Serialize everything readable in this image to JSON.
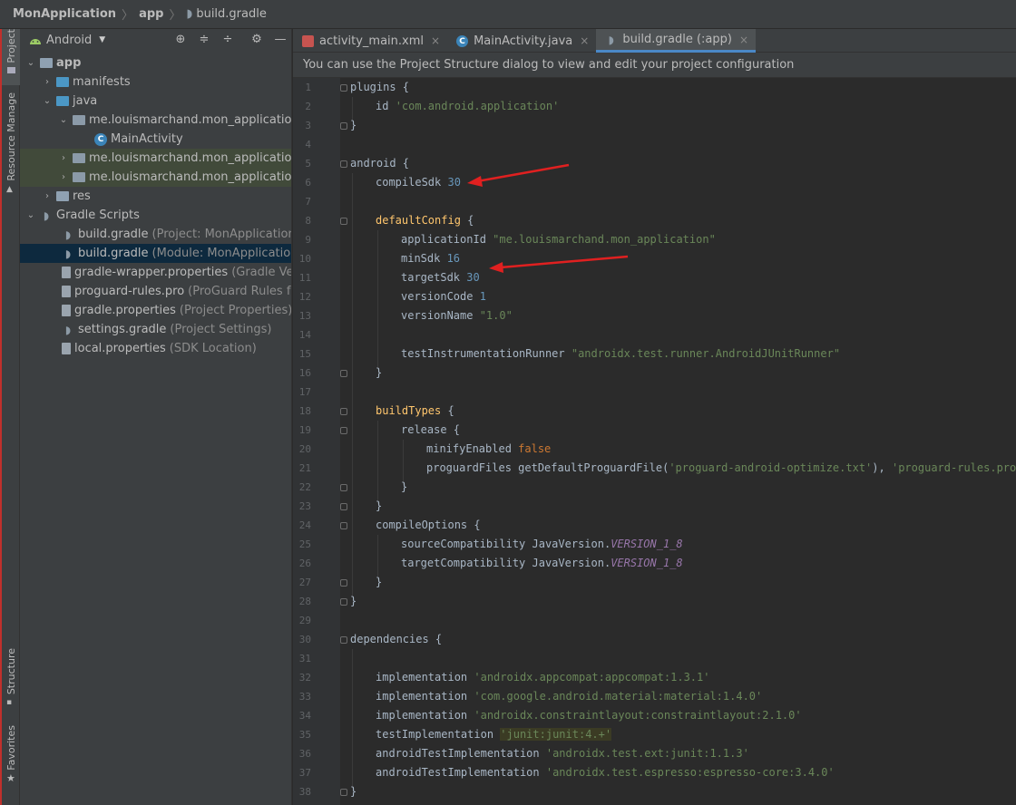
{
  "breadcrumb": {
    "project": "MonApplication",
    "module": "app",
    "file": "build.gradle"
  },
  "side_tabs": {
    "project": "Project",
    "resource_manager": "Resource Manage",
    "structure": "Structure",
    "favorites": "Favorites"
  },
  "project_panel": {
    "view_selector": "Android",
    "tree": [
      {
        "label": "app",
        "bold": true
      },
      {
        "label": "manifests"
      },
      {
        "label": "java"
      },
      {
        "label": "me.louismarchand.mon_application"
      },
      {
        "label": "MainActivity"
      },
      {
        "label": "me.louismarchand.mon_application"
      },
      {
        "label": "me.louismarchand.mon_application"
      },
      {
        "label": "res"
      },
      {
        "label": "Gradle Scripts"
      },
      {
        "label": "build.gradle",
        "hint": "(Project: MonApplication)"
      },
      {
        "label": "build.gradle",
        "hint": "(Module: MonApplication.a"
      },
      {
        "label": "gradle-wrapper.properties",
        "hint": "(Gradle Vers"
      },
      {
        "label": "proguard-rules.pro",
        "hint": "(ProGuard Rules for"
      },
      {
        "label": "gradle.properties",
        "hint": "(Project Properties)"
      },
      {
        "label": "settings.gradle",
        "hint": "(Project Settings)"
      },
      {
        "label": "local.properties",
        "hint": "(SDK Location)"
      }
    ]
  },
  "editor_tabs": [
    {
      "label": "activity_main.xml"
    },
    {
      "label": "MainActivity.java"
    },
    {
      "label": "build.gradle (:app)",
      "active": true
    }
  ],
  "info_banner": "You can use the Project Structure dialog to view and edit your project configuration",
  "line_numbers": [
    "1",
    "2",
    "3",
    "4",
    "5",
    "6",
    "7",
    "8",
    "9",
    "10",
    "11",
    "12",
    "13",
    "14",
    "15",
    "16",
    "17",
    "18",
    "19",
    "20",
    "21",
    "22",
    "23",
    "24",
    "25",
    "26",
    "27",
    "28",
    "29",
    "30",
    "31",
    "32",
    "33",
    "34",
    "35",
    "36",
    "37",
    "38"
  ],
  "code": {
    "l1": "plugins {",
    "l2_id": "id ",
    "l2_str": "'com.android.application'",
    "l3": "}",
    "l5": "android {",
    "l6_key": "compileSdk ",
    "l6_val": "30",
    "l8_fn": "defaultConfig",
    "l8_rest": " {",
    "l9_key": "applicationId ",
    "l9_val": "\"me.louismarchand.mon_application\"",
    "l10_key": "minSdk ",
    "l10_val": "16",
    "l11_key": "targetSdk ",
    "l11_val": "30",
    "l12_key": "versionCode ",
    "l12_val": "1",
    "l13_key": "versionName ",
    "l13_val": "\"1.0\"",
    "l15_key": "testInstrumentationRunner ",
    "l15_val": "\"androidx.test.runner.AndroidJUnitRunner\"",
    "l16": "}",
    "l18_fn": "buildTypes",
    "l18_rest": " {",
    "l19": "release {",
    "l20_key": "minifyEnabled ",
    "l20_val": "false",
    "l21_key": "proguardFiles getDefaultProguardFile(",
    "l21_str1": "'proguard-android-optimize.txt'",
    "l21_mid": "), ",
    "l21_str2": "'proguard-rules.pro'",
    "l22": "}",
    "l23": "}",
    "l24": "compileOptions {",
    "l25_key": "sourceCompatibility JavaVersion.",
    "l25_val": "VERSION_1_8",
    "l26_key": "targetCompatibility JavaVersion.",
    "l26_val": "VERSION_1_8",
    "l27": "}",
    "l28": "}",
    "l30": "dependencies {",
    "l32_key": "implementation ",
    "l32_val": "'androidx.appcompat:appcompat:1.3.1'",
    "l33_key": "implementation ",
    "l33_val": "'com.google.android.material:material:1.4.0'",
    "l34_key": "implementation ",
    "l34_val": "'androidx.constraintlayout:constraintlayout:2.1.0'",
    "l35_key": "testImplementation ",
    "l35_val": "'junit:junit:4.+'",
    "l36_key": "androidTestImplementation ",
    "l36_val": "'androidx.test.ext:junit:1.1.3'",
    "l37_key": "androidTestImplementation ",
    "l37_val": "'androidx.test.espresso:espresso-core:3.4.0'",
    "l38": "}"
  },
  "colors": {
    "accent": "#4a88c7",
    "annotation_arrow": "#e02020",
    "string": "#6a8759",
    "number": "#6897bb",
    "keyword": "#cc7832"
  }
}
